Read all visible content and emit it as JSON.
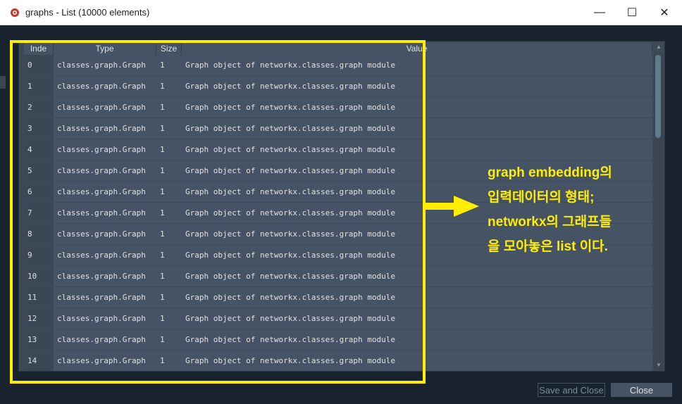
{
  "window": {
    "title": "graphs - List (10000 elements)",
    "minimize_glyph": "—",
    "maximize_glyph": "☐",
    "close_glyph": "✕"
  },
  "table": {
    "columns": [
      "Inde",
      "Type",
      "Size",
      "Value"
    ],
    "rows": [
      {
        "index": "0",
        "type": "classes.graph.Graph",
        "size": "1",
        "value": "Graph object of networkx.classes.graph module"
      },
      {
        "index": "1",
        "type": "classes.graph.Graph",
        "size": "1",
        "value": "Graph object of networkx.classes.graph module"
      },
      {
        "index": "2",
        "type": "classes.graph.Graph",
        "size": "1",
        "value": "Graph object of networkx.classes.graph module"
      },
      {
        "index": "3",
        "type": "classes.graph.Graph",
        "size": "1",
        "value": "Graph object of networkx.classes.graph module"
      },
      {
        "index": "4",
        "type": "classes.graph.Graph",
        "size": "1",
        "value": "Graph object of networkx.classes.graph module"
      },
      {
        "index": "5",
        "type": "classes.graph.Graph",
        "size": "1",
        "value": "Graph object of networkx.classes.graph module"
      },
      {
        "index": "6",
        "type": "classes.graph.Graph",
        "size": "1",
        "value": "Graph object of networkx.classes.graph module"
      },
      {
        "index": "7",
        "type": "classes.graph.Graph",
        "size": "1",
        "value": "Graph object of networkx.classes.graph module"
      },
      {
        "index": "8",
        "type": "classes.graph.Graph",
        "size": "1",
        "value": "Graph object of networkx.classes.graph module"
      },
      {
        "index": "9",
        "type": "classes.graph.Graph",
        "size": "1",
        "value": "Graph object of networkx.classes.graph module"
      },
      {
        "index": "10",
        "type": "classes.graph.Graph",
        "size": "1",
        "value": "Graph object of networkx.classes.graph module"
      },
      {
        "index": "11",
        "type": "classes.graph.Graph",
        "size": "1",
        "value": "Graph object of networkx.classes.graph module"
      },
      {
        "index": "12",
        "type": "classes.graph.Graph",
        "size": "1",
        "value": "Graph object of networkx.classes.graph module"
      },
      {
        "index": "13",
        "type": "classes.graph.Graph",
        "size": "1",
        "value": "Graph object of networkx.classes.graph module"
      },
      {
        "index": "14",
        "type": "classes.graph.Graph",
        "size": "1",
        "value": "Graph object of networkx.classes.graph module"
      }
    ]
  },
  "annotation": {
    "lines": [
      "graph embedding의",
      "입력데이터의 형태;",
      "networkx의 그래프들",
      "을 모아놓은 list 이다."
    ],
    "color": "#ffee00"
  },
  "buttons": {
    "save_and_close": "Save and Close",
    "close": "Close"
  },
  "colors": {
    "background": "#19232d",
    "row": "#455364",
    "highlight": "#ffee00"
  }
}
